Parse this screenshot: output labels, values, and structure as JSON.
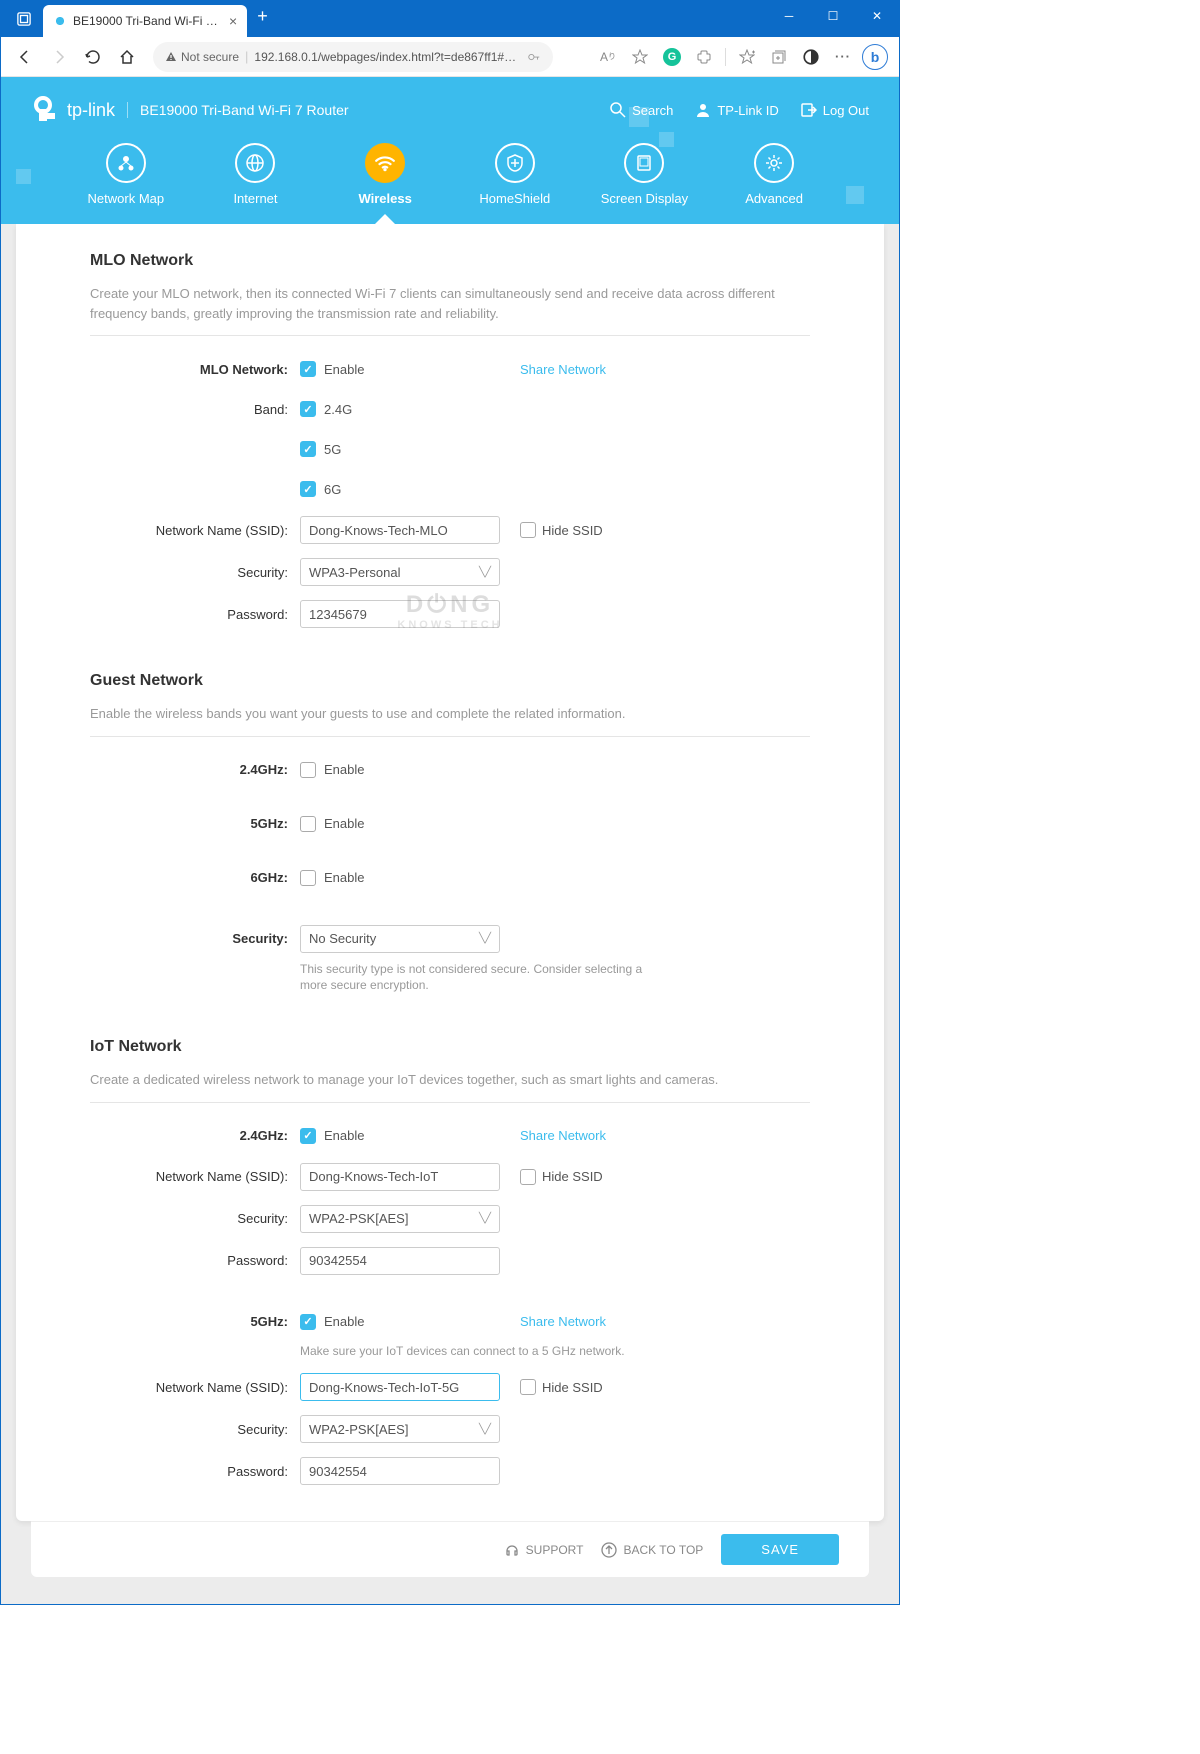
{
  "browser": {
    "tab_title": "BE19000 Tri-Band Wi-Fi 7 Router",
    "not_secure": "Not secure",
    "url": "192.168.0.1/webpages/index.html?t=de867ff1#wireles..."
  },
  "header": {
    "brand": "tp-link",
    "model": "BE19000 Tri-Band Wi-Fi 7 Router",
    "links": {
      "search": "Search",
      "tplink_id": "TP-Link ID",
      "logout": "Log Out"
    }
  },
  "nav": {
    "network_map": "Network Map",
    "internet": "Internet",
    "wireless": "Wireless",
    "homeshield": "HomeShield",
    "screen_display": "Screen Display",
    "advanced": "Advanced"
  },
  "mlo": {
    "title": "MLO Network",
    "desc": "Create your MLO network, then its connected Wi-Fi 7 clients can simultaneously send and receive data across different frequency bands, greatly improving the transmission rate and reliability.",
    "label_mlo": "MLO Network:",
    "enable": "Enable",
    "share": "Share Network",
    "label_band": "Band:",
    "band_24": "2.4G",
    "band_5": "5G",
    "band_6": "6G",
    "label_ssid": "Network Name (SSID):",
    "ssid": "Dong-Knows-Tech-MLO",
    "hide_ssid": "Hide SSID",
    "label_security": "Security:",
    "security": "WPA3-Personal",
    "label_password": "Password:",
    "password": "12345679"
  },
  "guest": {
    "title": "Guest Network",
    "desc": "Enable the wireless bands you want your guests to use and complete the related information.",
    "label_24": "2.4GHz:",
    "label_5": "5GHz:",
    "label_6": "6GHz:",
    "enable": "Enable",
    "label_security": "Security:",
    "security": "No Security",
    "warn": "This security type is not considered secure. Consider selecting a more secure encryption."
  },
  "iot": {
    "title": "IoT Network",
    "desc": "Create a dedicated wireless network to manage your IoT devices together, such as smart lights and cameras.",
    "label_24": "2.4GHz:",
    "enable": "Enable",
    "share": "Share Network",
    "label_ssid": "Network Name (SSID):",
    "ssid_24": "Dong-Knows-Tech-IoT",
    "hide_ssid": "Hide SSID",
    "label_security": "Security:",
    "security_24": "WPA2-PSK[AES]",
    "label_password": "Password:",
    "password_24": "90342554",
    "label_5": "5GHz:",
    "note_5": "Make sure your IoT devices can connect to a 5 GHz network.",
    "ssid_5": "Dong-Knows-Tech-IoT-5G",
    "security_5": "WPA2-PSK[AES]",
    "password_5": "90342554"
  },
  "footer": {
    "support": "SUPPORT",
    "back_to_top": "BACK TO TOP",
    "save": "SAVE"
  },
  "watermark": {
    "main": "D⏻NG",
    "sub": "KNOWS TECH"
  }
}
